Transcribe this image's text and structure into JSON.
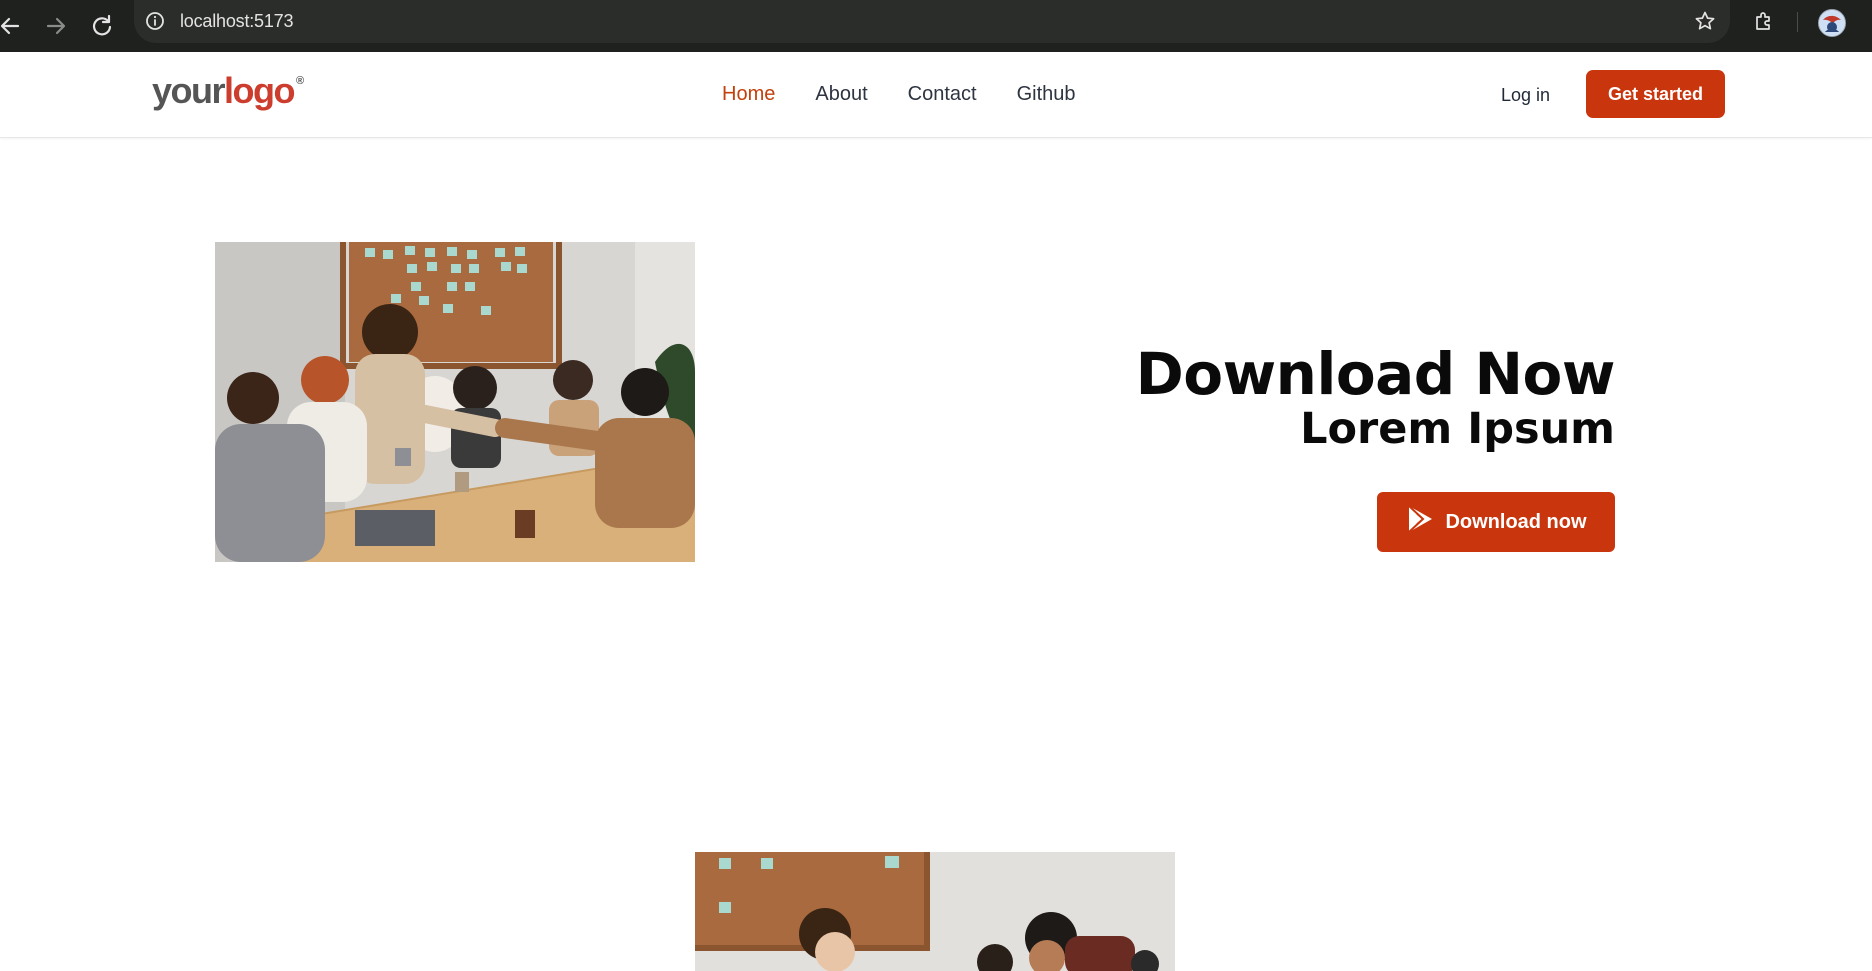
{
  "browser": {
    "url": "localhost:5173",
    "icons": [
      "back-arrow-icon",
      "forward-arrow-icon",
      "reload-icon",
      "info-icon",
      "star-icon",
      "extensions-icon",
      "profile-avatar"
    ]
  },
  "header": {
    "logo": {
      "part1": "your",
      "part2": "logo",
      "mark": "®"
    },
    "nav": [
      {
        "label": "Home",
        "active": true
      },
      {
        "label": "About",
        "active": false
      },
      {
        "label": "Contact",
        "active": false
      },
      {
        "label": "Github",
        "active": false
      }
    ],
    "login_label": "Log in",
    "cta_label": "Get started"
  },
  "hero": {
    "title": "Download Now",
    "subtitle": "Lorem Ipsum",
    "button_label": "Download now",
    "button_icon": "play-store-icon"
  },
  "colors": {
    "accent": "#c9350c",
    "active_nav": "#c2410c",
    "chrome_bg": "#1f211f"
  }
}
